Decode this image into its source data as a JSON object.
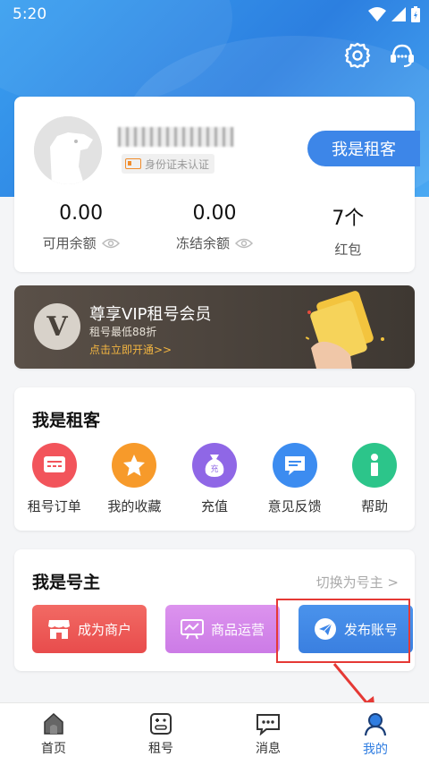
{
  "status": {
    "time": "5:20"
  },
  "profile": {
    "id_status": "身份证未认证",
    "role_button": "我是租客",
    "stats": [
      {
        "value": "0.00",
        "label": "可用余额",
        "eye": true
      },
      {
        "value": "0.00",
        "label": "冻结余额",
        "eye": true
      },
      {
        "value": "7个",
        "label": "红包",
        "eye": false
      }
    ]
  },
  "vip": {
    "logo": "V",
    "title": "尊享VIP租号会员",
    "subtitle": "租号最低88折",
    "cta": "点击立即开通>>"
  },
  "renter": {
    "title": "我是租客",
    "items": [
      {
        "label": "租号订单",
        "icon": "order-icon",
        "color": "#f2545b"
      },
      {
        "label": "我的收藏",
        "icon": "star-icon",
        "color": "#f79a2a"
      },
      {
        "label": "充值",
        "icon": "recharge-icon",
        "color": "#8f67e6"
      },
      {
        "label": "意见反馈",
        "icon": "feedback-icon",
        "color": "#3c8cf0"
      },
      {
        "label": "帮助",
        "icon": "info-icon",
        "color": "#2cc58a"
      }
    ]
  },
  "owner": {
    "title": "我是号主",
    "switch": "切换为号主 >",
    "buttons": [
      {
        "label": "成为商户",
        "icon": "store-icon",
        "color": "#ee5a5a"
      },
      {
        "label": "商品运营",
        "icon": "chart-board-icon",
        "color": "#d486ea"
      },
      {
        "label": "发布账号",
        "icon": "send-icon",
        "color": "#3d86e8"
      }
    ]
  },
  "tabbar": {
    "tabs": [
      {
        "label": "首页",
        "icon": "home-icon",
        "active": false
      },
      {
        "label": "租号",
        "icon": "gamepad-icon",
        "active": false
      },
      {
        "label": "消息",
        "icon": "message-icon",
        "active": false
      },
      {
        "label": "我的",
        "icon": "profile-icon",
        "active": true
      }
    ]
  },
  "colors": {
    "primary": "#3d86e8",
    "accent_red": "#e53935",
    "vip_gold": "#f2b541"
  }
}
